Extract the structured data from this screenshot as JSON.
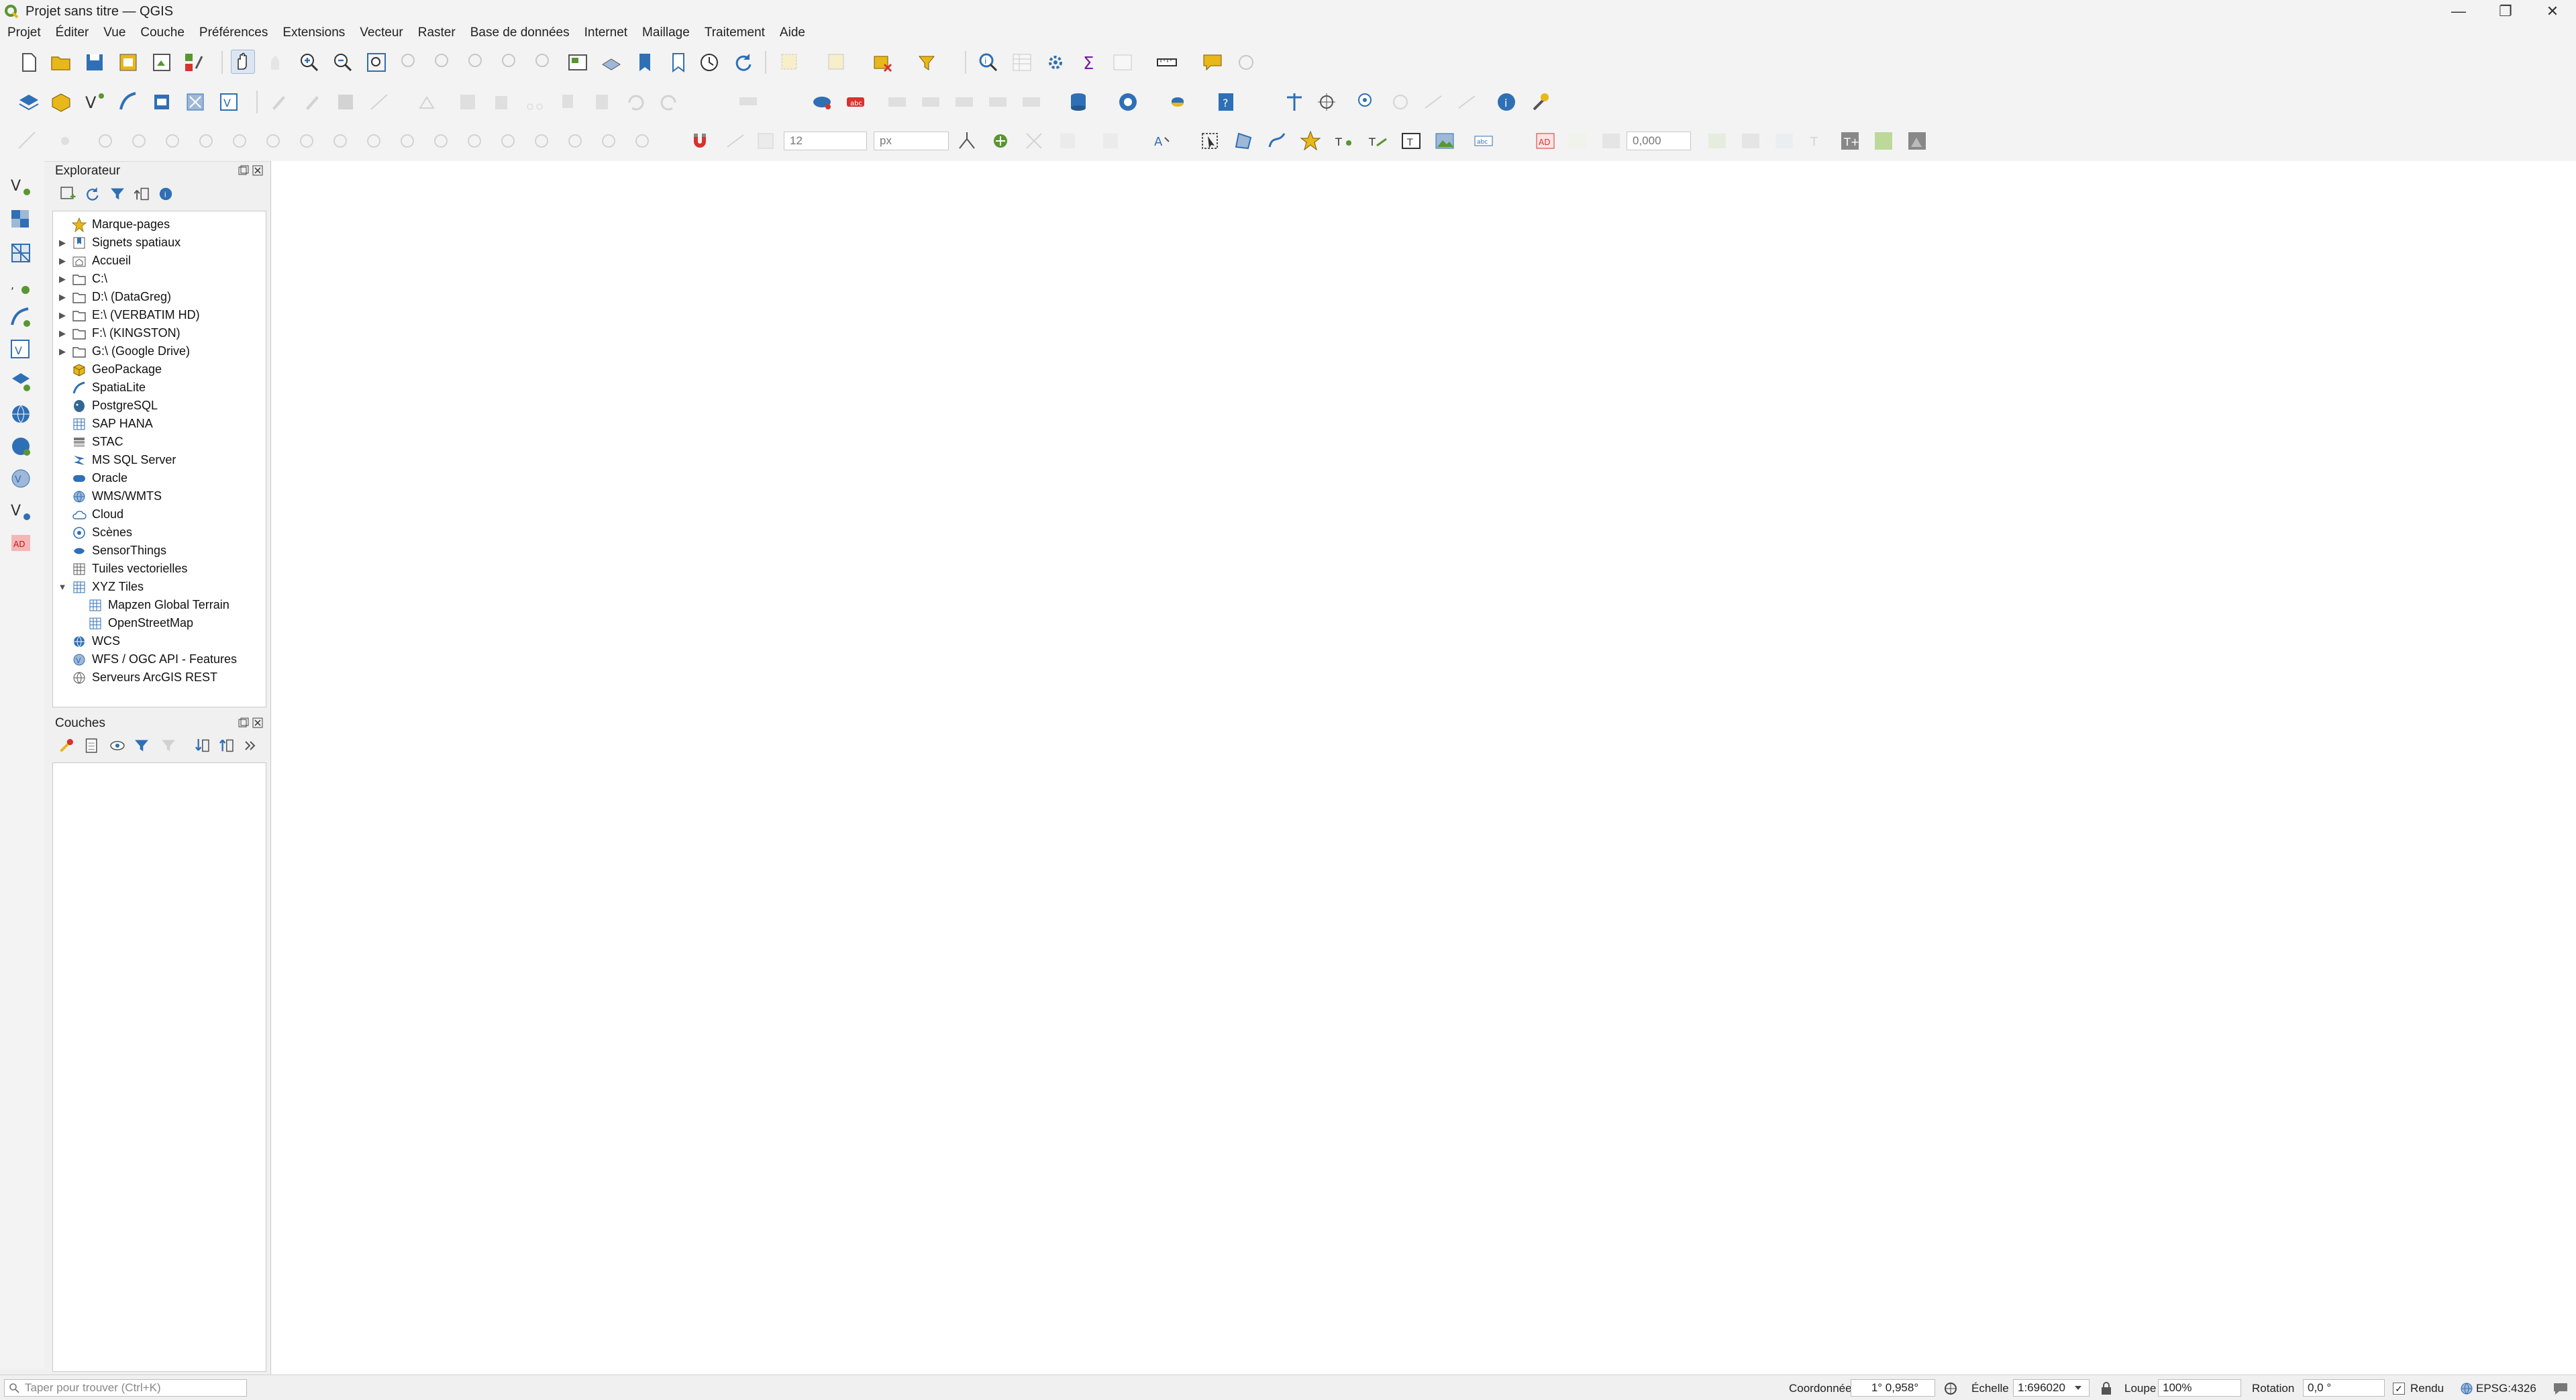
{
  "window": {
    "title": "Projet sans titre — QGIS",
    "controls": [
      "—",
      "❐",
      "✕"
    ]
  },
  "menu": [
    "Projet",
    "Éditer",
    "Vue",
    "Couche",
    "Préférences",
    "Extensions",
    "Vecteur",
    "Raster",
    "Base de données",
    "Internet",
    "Maillage",
    "Traitement",
    "Aide"
  ],
  "toolbar": {
    "snap_size": "12",
    "snap_unit": "px",
    "label_offset": "0,000"
  },
  "explorer": {
    "title": "Explorateur",
    "items": [
      {
        "label": "Marque-pages",
        "icon": "star-icon",
        "expandable": false,
        "indent": 0
      },
      {
        "label": "Signets spatiaux",
        "icon": "spatial-bookmark-icon",
        "expandable": true,
        "indent": 0
      },
      {
        "label": "Accueil",
        "icon": "home-folder-icon",
        "expandable": true,
        "indent": 0
      },
      {
        "label": "C:\\",
        "icon": "folder-icon",
        "expandable": true,
        "indent": 0
      },
      {
        "label": "D:\\ (DataGreg)",
        "icon": "folder-icon",
        "expandable": true,
        "indent": 0
      },
      {
        "label": "E:\\ (VERBATIM HD)",
        "icon": "folder-icon",
        "expandable": true,
        "indent": 0
      },
      {
        "label": "F:\\ (KINGSTON)",
        "icon": "folder-icon",
        "expandable": true,
        "indent": 0
      },
      {
        "label": "G:\\ (Google Drive)",
        "icon": "folder-icon",
        "expandable": true,
        "indent": 0
      },
      {
        "label": "GeoPackage",
        "icon": "geopackage-icon",
        "expandable": false,
        "indent": 0
      },
      {
        "label": "SpatiaLite",
        "icon": "spatialite-icon",
        "expandable": false,
        "indent": 0
      },
      {
        "label": "PostgreSQL",
        "icon": "postgresql-icon",
        "expandable": false,
        "indent": 0
      },
      {
        "label": "SAP HANA",
        "icon": "sap-hana-icon",
        "expandable": false,
        "indent": 0
      },
      {
        "label": "STAC",
        "icon": "stac-icon",
        "expandable": false,
        "indent": 0
      },
      {
        "label": "MS SQL Server",
        "icon": "mssql-icon",
        "expandable": false,
        "indent": 0
      },
      {
        "label": "Oracle",
        "icon": "oracle-icon",
        "expandable": false,
        "indent": 0
      },
      {
        "label": "WMS/WMTS",
        "icon": "wms-icon",
        "expandable": false,
        "indent": 0
      },
      {
        "label": "Cloud",
        "icon": "cloud-icon",
        "expandable": false,
        "indent": 0
      },
      {
        "label": "Scènes",
        "icon": "scenes-icon",
        "expandable": false,
        "indent": 0
      },
      {
        "label": "SensorThings",
        "icon": "sensorthings-icon",
        "expandable": false,
        "indent": 0
      },
      {
        "label": "Tuiles vectorielles",
        "icon": "vector-tiles-icon",
        "expandable": false,
        "indent": 0
      },
      {
        "label": "XYZ Tiles",
        "icon": "xyz-tiles-icon",
        "expandable": true,
        "expanded": true,
        "indent": 0
      },
      {
        "label": "Mapzen Global Terrain",
        "icon": "xyz-tiles-icon",
        "expandable": false,
        "indent": 1
      },
      {
        "label": "OpenStreetMap",
        "icon": "xyz-tiles-icon",
        "expandable": false,
        "indent": 1
      },
      {
        "label": "WCS",
        "icon": "wcs-icon",
        "expandable": false,
        "indent": 0
      },
      {
        "label": "WFS / OGC API - Features",
        "icon": "wfs-icon",
        "expandable": false,
        "indent": 0
      },
      {
        "label": "Serveurs ArcGIS REST",
        "icon": "arcgis-rest-icon",
        "expandable": false,
        "indent": 0
      }
    ]
  },
  "layers": {
    "title": "Couches"
  },
  "statusbar": {
    "locator_placeholder": "Taper pour trouver (Ctrl+K)",
    "coord_label": "Coordonnée",
    "coord_value": "1° 0,958°",
    "scale_label": "Échelle",
    "scale_value": "1:696020",
    "magnifier_label": "Loupe",
    "magnifier_value": "100%",
    "rotation_label": "Rotation",
    "rotation_value": "0,0 °",
    "render_label": "Rendu",
    "crs": "EPSG:4326"
  },
  "colors": {
    "accent_blue": "#2f6fb5",
    "qgis_green": "#589632",
    "yellow": "#e8b71a",
    "red": "#d8322e"
  }
}
